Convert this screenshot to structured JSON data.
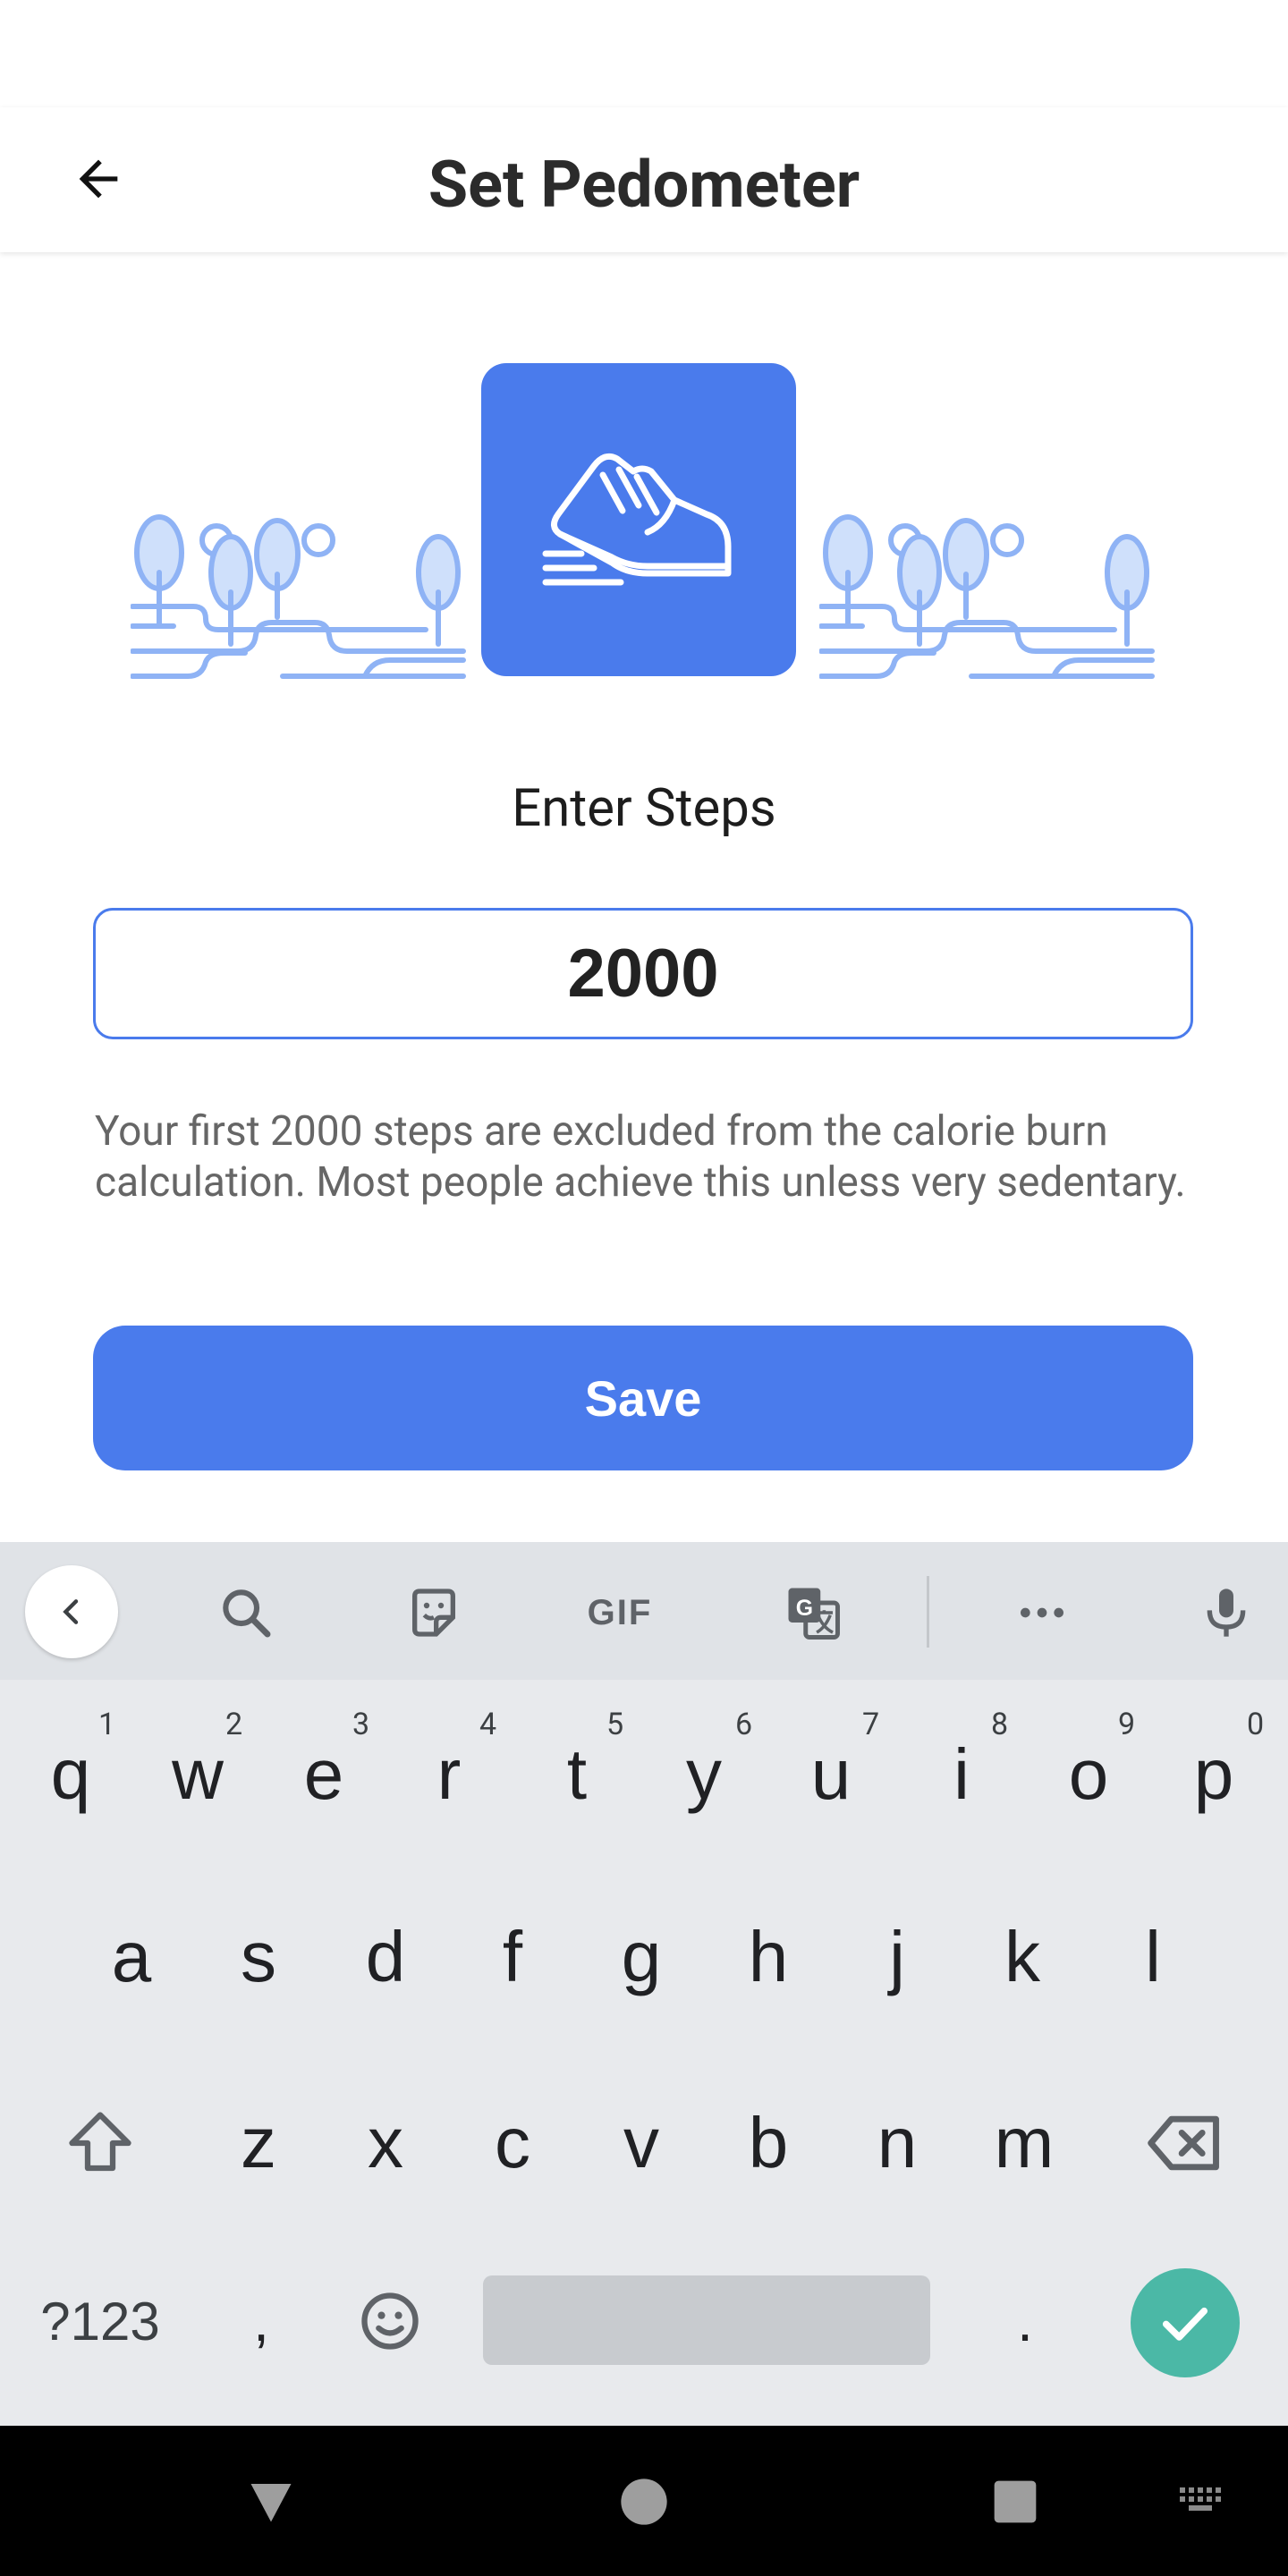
{
  "app_bar": {
    "title": "Set Pedometer",
    "back_icon": "arrow-back-icon"
  },
  "hero": {
    "shoe_icon": "sneaker-icon",
    "scenery_icon": "park-trees-icon",
    "accent_color": "#4a7bec",
    "scenery_color": "#8fb3f5"
  },
  "form": {
    "label": "Enter Steps",
    "steps_value": "2000",
    "info": "Your first 2000 steps are excluded from the calorie burn calculation. Most people achieve this unless very sedentary.",
    "save_label": "Save"
  },
  "keyboard": {
    "toolbar": {
      "collapse_icon": "chevron-left-icon",
      "search_icon": "search-icon",
      "sticker_icon": "sticker-icon",
      "gif_label": "GIF",
      "translate_icon": "translate-icon",
      "more_icon": "more-horizontal-icon",
      "mic_icon": "microphone-icon"
    },
    "row1": [
      "q",
      "w",
      "e",
      "r",
      "t",
      "y",
      "u",
      "i",
      "o",
      "p"
    ],
    "row1_hints": [
      "1",
      "2",
      "3",
      "4",
      "5",
      "6",
      "7",
      "8",
      "9",
      "0"
    ],
    "row2": [
      "a",
      "s",
      "d",
      "f",
      "g",
      "h",
      "j",
      "k",
      "l"
    ],
    "row3": [
      "z",
      "x",
      "c",
      "v",
      "b",
      "n",
      "m"
    ],
    "shift_icon": "shift-icon",
    "backspace_icon": "backspace-icon",
    "symbols_label": "?123",
    "comma_label": ",",
    "emoji_icon": "emoji-icon",
    "period_label": ".",
    "enter_icon": "check-icon",
    "enter_color": "#4bb8a6"
  },
  "nav_bar": {
    "back_icon": "nav-back-triangle-icon",
    "home_icon": "nav-home-circle-icon",
    "recents_icon": "nav-recents-square-icon",
    "keyboard_icon": "keyboard-switch-icon"
  }
}
